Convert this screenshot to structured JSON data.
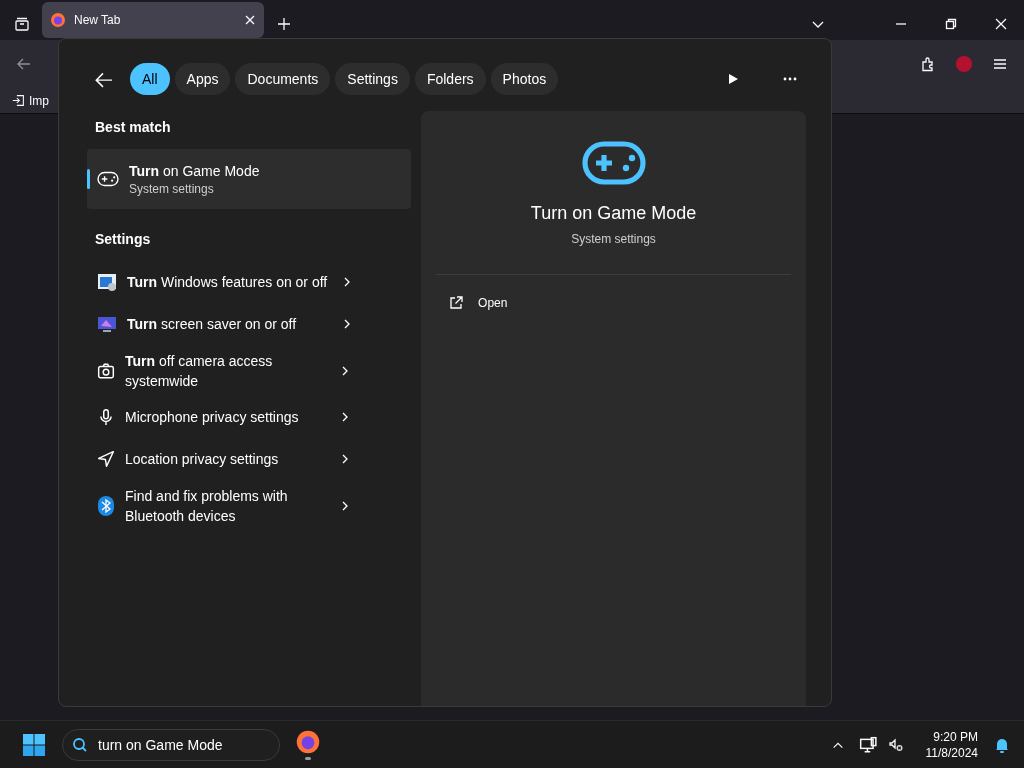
{
  "browser": {
    "tabs": [
      {
        "title": "New Tab",
        "selected": true
      }
    ],
    "bookmarks": [
      {
        "label": "Imp"
      }
    ]
  },
  "search_flyout": {
    "filters": [
      {
        "label": "All",
        "selected": true
      },
      {
        "label": "Apps",
        "selected": false
      },
      {
        "label": "Documents",
        "selected": false
      },
      {
        "label": "Settings",
        "selected": false
      },
      {
        "label": "Folders",
        "selected": false
      },
      {
        "label": "Photos",
        "selected": false
      }
    ],
    "best_match": {
      "heading": "Best match",
      "item": {
        "title": "**Turn** on Game Mode",
        "subtitle": "System settings",
        "selected": true
      }
    },
    "settings": {
      "heading": "Settings",
      "items": [
        {
          "title": "**Turn** Windows features on or off"
        },
        {
          "title": "**Turn** screen saver on or off"
        },
        {
          "title": "**Turn** off camera access systemwide"
        },
        {
          "title": "Microphone privacy settings"
        },
        {
          "title": "Location privacy settings"
        },
        {
          "title": "Find and fix problems with Bluetooth devices"
        }
      ]
    },
    "preview": {
      "title": "Turn on Game Mode",
      "subtitle": "System settings",
      "actions": [
        {
          "label": "Open"
        }
      ]
    }
  },
  "taskbar": {
    "search": {
      "value": "turn on Game Mode"
    },
    "clock": {
      "time": "9:20 PM",
      "date": "11/8/2024"
    }
  }
}
